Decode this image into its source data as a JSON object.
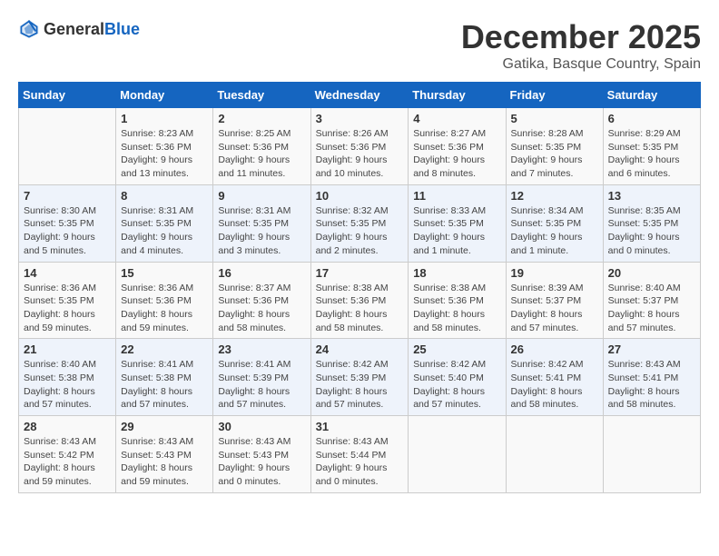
{
  "logo": {
    "text_general": "General",
    "text_blue": "Blue"
  },
  "header": {
    "title": "December 2025",
    "subtitle": "Gatika, Basque Country, Spain"
  },
  "days_of_week": [
    "Sunday",
    "Monday",
    "Tuesday",
    "Wednesday",
    "Thursday",
    "Friday",
    "Saturday"
  ],
  "weeks": [
    [
      {
        "day": "",
        "sunrise": "",
        "sunset": "",
        "daylight": ""
      },
      {
        "day": "1",
        "sunrise": "Sunrise: 8:23 AM",
        "sunset": "Sunset: 5:36 PM",
        "daylight": "Daylight: 9 hours and 13 minutes."
      },
      {
        "day": "2",
        "sunrise": "Sunrise: 8:25 AM",
        "sunset": "Sunset: 5:36 PM",
        "daylight": "Daylight: 9 hours and 11 minutes."
      },
      {
        "day": "3",
        "sunrise": "Sunrise: 8:26 AM",
        "sunset": "Sunset: 5:36 PM",
        "daylight": "Daylight: 9 hours and 10 minutes."
      },
      {
        "day": "4",
        "sunrise": "Sunrise: 8:27 AM",
        "sunset": "Sunset: 5:36 PM",
        "daylight": "Daylight: 9 hours and 8 minutes."
      },
      {
        "day": "5",
        "sunrise": "Sunrise: 8:28 AM",
        "sunset": "Sunset: 5:35 PM",
        "daylight": "Daylight: 9 hours and 7 minutes."
      },
      {
        "day": "6",
        "sunrise": "Sunrise: 8:29 AM",
        "sunset": "Sunset: 5:35 PM",
        "daylight": "Daylight: 9 hours and 6 minutes."
      }
    ],
    [
      {
        "day": "7",
        "sunrise": "Sunrise: 8:30 AM",
        "sunset": "Sunset: 5:35 PM",
        "daylight": "Daylight: 9 hours and 5 minutes."
      },
      {
        "day": "8",
        "sunrise": "Sunrise: 8:31 AM",
        "sunset": "Sunset: 5:35 PM",
        "daylight": "Daylight: 9 hours and 4 minutes."
      },
      {
        "day": "9",
        "sunrise": "Sunrise: 8:31 AM",
        "sunset": "Sunset: 5:35 PM",
        "daylight": "Daylight: 9 hours and 3 minutes."
      },
      {
        "day": "10",
        "sunrise": "Sunrise: 8:32 AM",
        "sunset": "Sunset: 5:35 PM",
        "daylight": "Daylight: 9 hours and 2 minutes."
      },
      {
        "day": "11",
        "sunrise": "Sunrise: 8:33 AM",
        "sunset": "Sunset: 5:35 PM",
        "daylight": "Daylight: 9 hours and 1 minute."
      },
      {
        "day": "12",
        "sunrise": "Sunrise: 8:34 AM",
        "sunset": "Sunset: 5:35 PM",
        "daylight": "Daylight: 9 hours and 1 minute."
      },
      {
        "day": "13",
        "sunrise": "Sunrise: 8:35 AM",
        "sunset": "Sunset: 5:35 PM",
        "daylight": "Daylight: 9 hours and 0 minutes."
      }
    ],
    [
      {
        "day": "14",
        "sunrise": "Sunrise: 8:36 AM",
        "sunset": "Sunset: 5:35 PM",
        "daylight": "Daylight: 8 hours and 59 minutes."
      },
      {
        "day": "15",
        "sunrise": "Sunrise: 8:36 AM",
        "sunset": "Sunset: 5:36 PM",
        "daylight": "Daylight: 8 hours and 59 minutes."
      },
      {
        "day": "16",
        "sunrise": "Sunrise: 8:37 AM",
        "sunset": "Sunset: 5:36 PM",
        "daylight": "Daylight: 8 hours and 58 minutes."
      },
      {
        "day": "17",
        "sunrise": "Sunrise: 8:38 AM",
        "sunset": "Sunset: 5:36 PM",
        "daylight": "Daylight: 8 hours and 58 minutes."
      },
      {
        "day": "18",
        "sunrise": "Sunrise: 8:38 AM",
        "sunset": "Sunset: 5:36 PM",
        "daylight": "Daylight: 8 hours and 58 minutes."
      },
      {
        "day": "19",
        "sunrise": "Sunrise: 8:39 AM",
        "sunset": "Sunset: 5:37 PM",
        "daylight": "Daylight: 8 hours and 57 minutes."
      },
      {
        "day": "20",
        "sunrise": "Sunrise: 8:40 AM",
        "sunset": "Sunset: 5:37 PM",
        "daylight": "Daylight: 8 hours and 57 minutes."
      }
    ],
    [
      {
        "day": "21",
        "sunrise": "Sunrise: 8:40 AM",
        "sunset": "Sunset: 5:38 PM",
        "daylight": "Daylight: 8 hours and 57 minutes."
      },
      {
        "day": "22",
        "sunrise": "Sunrise: 8:41 AM",
        "sunset": "Sunset: 5:38 PM",
        "daylight": "Daylight: 8 hours and 57 minutes."
      },
      {
        "day": "23",
        "sunrise": "Sunrise: 8:41 AM",
        "sunset": "Sunset: 5:39 PM",
        "daylight": "Daylight: 8 hours and 57 minutes."
      },
      {
        "day": "24",
        "sunrise": "Sunrise: 8:42 AM",
        "sunset": "Sunset: 5:39 PM",
        "daylight": "Daylight: 8 hours and 57 minutes."
      },
      {
        "day": "25",
        "sunrise": "Sunrise: 8:42 AM",
        "sunset": "Sunset: 5:40 PM",
        "daylight": "Daylight: 8 hours and 57 minutes."
      },
      {
        "day": "26",
        "sunrise": "Sunrise: 8:42 AM",
        "sunset": "Sunset: 5:41 PM",
        "daylight": "Daylight: 8 hours and 58 minutes."
      },
      {
        "day": "27",
        "sunrise": "Sunrise: 8:43 AM",
        "sunset": "Sunset: 5:41 PM",
        "daylight": "Daylight: 8 hours and 58 minutes."
      }
    ],
    [
      {
        "day": "28",
        "sunrise": "Sunrise: 8:43 AM",
        "sunset": "Sunset: 5:42 PM",
        "daylight": "Daylight: 8 hours and 59 minutes."
      },
      {
        "day": "29",
        "sunrise": "Sunrise: 8:43 AM",
        "sunset": "Sunset: 5:43 PM",
        "daylight": "Daylight: 8 hours and 59 minutes."
      },
      {
        "day": "30",
        "sunrise": "Sunrise: 8:43 AM",
        "sunset": "Sunset: 5:43 PM",
        "daylight": "Daylight: 9 hours and 0 minutes."
      },
      {
        "day": "31",
        "sunrise": "Sunrise: 8:43 AM",
        "sunset": "Sunset: 5:44 PM",
        "daylight": "Daylight: 9 hours and 0 minutes."
      },
      {
        "day": "",
        "sunrise": "",
        "sunset": "",
        "daylight": ""
      },
      {
        "day": "",
        "sunrise": "",
        "sunset": "",
        "daylight": ""
      },
      {
        "day": "",
        "sunrise": "",
        "sunset": "",
        "daylight": ""
      }
    ]
  ]
}
